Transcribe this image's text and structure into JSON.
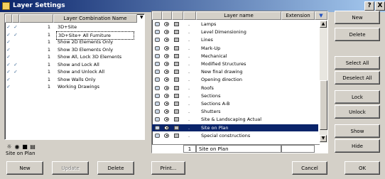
{
  "window": {
    "title": "Layer Settings",
    "help_button": "?",
    "close_button": "X"
  },
  "left_panel": {
    "header": "Layer Combination Name",
    "combinations": [
      {
        "col1": "✓",
        "col2": "✓",
        "num": "1",
        "name": "3D+Site"
      },
      {
        "col1": "✓",
        "col2": "✓",
        "num": "1",
        "name": "3D+Site+ All Furniture",
        "selected": true
      },
      {
        "col1": "✓",
        "col2": "",
        "num": "1",
        "name": "Show 2D Elements Only"
      },
      {
        "col1": "✓",
        "col2": "",
        "num": "1",
        "name": "Show 3D Elements Only"
      },
      {
        "col1": "✓",
        "col2": "",
        "num": "1",
        "name": "Show All, Lock 3D Elements"
      },
      {
        "col1": "✓",
        "col2": "✓",
        "num": "1",
        "name": "Show and Lock All"
      },
      {
        "col1": "✓",
        "col2": "✓",
        "num": "1",
        "name": "Show and Unlock All"
      },
      {
        "col1": "✓",
        "col2": "",
        "num": "1",
        "name": "Show Walls Only"
      },
      {
        "col1": "✓",
        "col2": "",
        "num": "1",
        "name": "Working Drawings"
      }
    ],
    "status_text": "Site on Plan",
    "new_button": "New",
    "update_button": "Update",
    "delete_button": "Delete"
  },
  "right_panel": {
    "header_layer_name": "Layer name",
    "header_extension": "Extension",
    "layers": [
      {
        "dot": ".",
        "name": "Lamps"
      },
      {
        "dot": ".",
        "name": "Level Dimensioning"
      },
      {
        "dot": ".",
        "name": "Lines"
      },
      {
        "dot": ".",
        "name": "Mark-Up"
      },
      {
        "dot": ".",
        "name": "Mechanical"
      },
      {
        "dot": ".",
        "name": "Modified Structures"
      },
      {
        "dot": ".",
        "name": "New final drawing"
      },
      {
        "dot": ".",
        "name": "Opening direction"
      },
      {
        "dot": ".",
        "name": "Roofs"
      },
      {
        "dot": ".",
        "name": "Sections"
      },
      {
        "dot": ".",
        "name": "Sections A-B"
      },
      {
        "dot": ".",
        "name": "Shutters"
      },
      {
        "dot": ".",
        "name": "Site & Landscaping Actual"
      },
      {
        "dot": ".",
        "name": "Site on Plan",
        "selected": true
      },
      {
        "dot": ".",
        "name": "Special constructions"
      }
    ],
    "edit_row": {
      "num": "1",
      "name": "Site on Plan"
    },
    "print_button": "Print..."
  },
  "side_buttons": {
    "new": "New",
    "delete": "Delete",
    "select_all": "Select All",
    "deselect_all": "Deselect All",
    "lock": "Lock",
    "unlock": "Unlock",
    "show": "Show",
    "hide": "Hide"
  },
  "footer": {
    "cancel": "Cancel",
    "ok": "OK"
  }
}
